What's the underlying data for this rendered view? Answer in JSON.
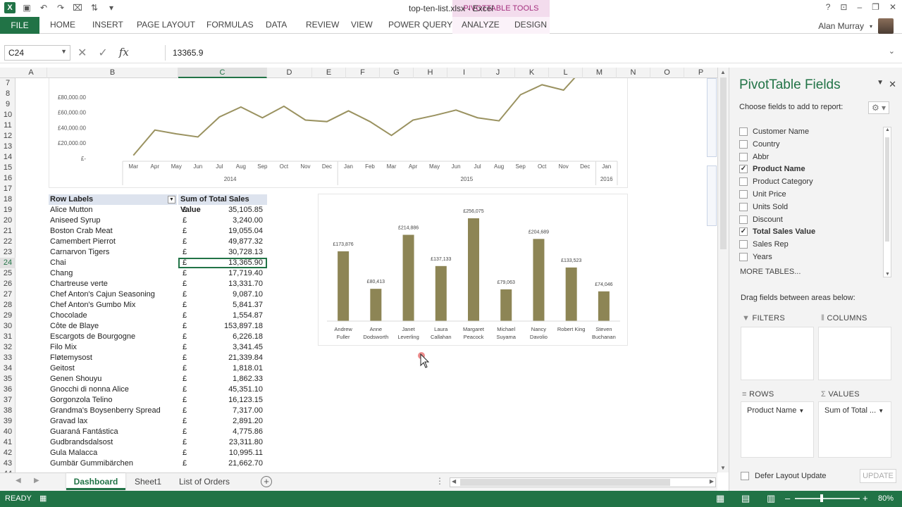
{
  "window": {
    "title": "top-ten-list.xlsx - Excel",
    "context_tab": "PIVOTTABLE TOOLS"
  },
  "ribbon": {
    "file": "FILE",
    "tabs": [
      "HOME",
      "INSERT",
      "PAGE LAYOUT",
      "FORMULAS",
      "DATA",
      "REVIEW",
      "VIEW",
      "POWER QUERY",
      "ANALYZE",
      "DESIGN"
    ],
    "user": "Alan Murray"
  },
  "formula_bar": {
    "name_box": "C24",
    "formula": "13365.9"
  },
  "columns": [
    "A",
    "B",
    "C",
    "D",
    "E",
    "F",
    "G",
    "H",
    "I",
    "J",
    "K",
    "L",
    "M",
    "N",
    "O",
    "P"
  ],
  "selected_column": "C",
  "rows": [
    7,
    8,
    9,
    10,
    11,
    12,
    13,
    14,
    15,
    16,
    17,
    18,
    19,
    20,
    21,
    22,
    23,
    24,
    25,
    26,
    27,
    28,
    29,
    30,
    31,
    32,
    33,
    34,
    35,
    36,
    37,
    38,
    39,
    40,
    41,
    42,
    43,
    44
  ],
  "selected_row": 24,
  "pivot": {
    "row_labels": "Row Labels",
    "value_header": "Sum of Total Sales Value",
    "currency": "£",
    "rows": [
      {
        "name": "Alice Mutton",
        "value": "35,105.85"
      },
      {
        "name": "Aniseed Syrup",
        "value": "3,240.00"
      },
      {
        "name": "Boston Crab Meat",
        "value": "19,055.04"
      },
      {
        "name": "Camembert Pierrot",
        "value": "49,877.32"
      },
      {
        "name": "Carnarvon Tigers",
        "value": "30,728.13"
      },
      {
        "name": "Chai",
        "value": "13,365.90"
      },
      {
        "name": "Chang",
        "value": "17,719.40"
      },
      {
        "name": "Chartreuse verte",
        "value": "13,331.70"
      },
      {
        "name": "Chef Anton's Cajun Seasoning",
        "value": "9,087.10"
      },
      {
        "name": "Chef Anton's Gumbo Mix",
        "value": "5,841.37"
      },
      {
        "name": "Chocolade",
        "value": "1,554.87"
      },
      {
        "name": "Côte de Blaye",
        "value": "153,897.18"
      },
      {
        "name": "Escargots de Bourgogne",
        "value": "6,226.18"
      },
      {
        "name": "Filo Mix",
        "value": "3,341.45"
      },
      {
        "name": "Fløtemysost",
        "value": "21,339.84"
      },
      {
        "name": "Geitost",
        "value": "1,818.01"
      },
      {
        "name": "Genen Shouyu",
        "value": "1,862.33"
      },
      {
        "name": "Gnocchi di nonna Alice",
        "value": "45,351.10"
      },
      {
        "name": "Gorgonzola Telino",
        "value": "16,123.15"
      },
      {
        "name": "Grandma's Boysenberry Spread",
        "value": "7,317.00"
      },
      {
        "name": "Gravad lax",
        "value": "2,891.20"
      },
      {
        "name": "Guaraná Fantástica",
        "value": "4,775.86"
      },
      {
        "name": "Gudbrandsdalsost",
        "value": "23,311.80"
      },
      {
        "name": "Gula Malacca",
        "value": "10,995.11"
      },
      {
        "name": "Gumbär Gummibärchen",
        "value": "21,662.70"
      }
    ]
  },
  "chart_data": [
    {
      "type": "line",
      "x": [
        "Mar",
        "Apr",
        "May",
        "Jun",
        "Jul",
        "Aug",
        "Sep",
        "Oct",
        "Nov",
        "Dec",
        "Jan",
        "Feb",
        "Mar",
        "Apr",
        "May",
        "Jun",
        "Jul",
        "Aug",
        "Sep",
        "Oct",
        "Nov",
        "Dec",
        "Jan"
      ],
      "year_groups": [
        {
          "label": "2014",
          "count": 10
        },
        {
          "label": "2015",
          "count": 12
        },
        {
          "label": "2016",
          "count": 1
        }
      ],
      "y": [
        4000,
        37000,
        32000,
        28000,
        54000,
        67000,
        53000,
        68000,
        50000,
        48000,
        62000,
        48000,
        30000,
        50000,
        56000,
        63000,
        53000,
        49000,
        83000,
        96000,
        89000,
        120000,
        null
      ],
      "yticks": [
        "£-",
        "£20,000.00",
        "£40,000.00",
        "£60,000.00",
        "£80,000.00"
      ],
      "ylim": [
        0,
        100000
      ],
      "color": "#9a9260"
    },
    {
      "type": "bar",
      "categories": [
        "Andrew Fuller",
        "Anne Dodsworth",
        "Janet Leverling",
        "Laura Callahan",
        "Margaret Peacock",
        "Michael Suyama",
        "Nancy Davolio",
        "Robert King",
        "Steven Buchanan"
      ],
      "category_lines": [
        [
          "Andrew",
          "Fuller"
        ],
        [
          "Anne",
          "Dodsworth"
        ],
        [
          "Janet",
          "Leverling"
        ],
        [
          "Laura",
          "Callahan"
        ],
        [
          "Margaret",
          "Peacock"
        ],
        [
          "Michael",
          "Suyama"
        ],
        [
          "Nancy",
          "Davolio"
        ],
        [
          "Robert King"
        ],
        [
          "Steven",
          "Buchanan"
        ]
      ],
      "values": [
        173876,
        80413,
        214886,
        137133,
        256075,
        79063,
        204689,
        133523,
        74046
      ],
      "labels": [
        "£173,876",
        "£80,413",
        "£214,886",
        "£137,133",
        "£256,075",
        "£79,063",
        "£204,689",
        "£133,523",
        "£74,046"
      ],
      "ylim": [
        0,
        256075
      ],
      "color": "#8d8555"
    }
  ],
  "sheet_tabs": [
    "Dashboard",
    "Sheet1",
    "List of Orders"
  ],
  "status": {
    "ready": "READY",
    "zoom": "80%"
  },
  "pane": {
    "title": "PivotTable Fields",
    "choose": "Choose fields to add to report:",
    "fields": [
      {
        "label": "Customer Name",
        "checked": false
      },
      {
        "label": "Country",
        "checked": false
      },
      {
        "label": "Abbr",
        "checked": false
      },
      {
        "label": "Product Name",
        "checked": true
      },
      {
        "label": "Product Category",
        "checked": false
      },
      {
        "label": "Unit Price",
        "checked": false
      },
      {
        "label": "Units Sold",
        "checked": false
      },
      {
        "label": "Discount",
        "checked": false
      },
      {
        "label": "Total Sales Value",
        "checked": true
      },
      {
        "label": "Sales Rep",
        "checked": false
      },
      {
        "label": "Years",
        "checked": false
      }
    ],
    "more_tables": "MORE TABLES...",
    "drag_label": "Drag fields between areas below:",
    "filters": "FILTERS",
    "columns": "COLUMNS",
    "rows": "ROWS",
    "values": "VALUES",
    "rows_field": "Product Name",
    "values_field": "Sum of Total ...",
    "defer": "Defer Layout Update",
    "update": "UPDATE"
  }
}
